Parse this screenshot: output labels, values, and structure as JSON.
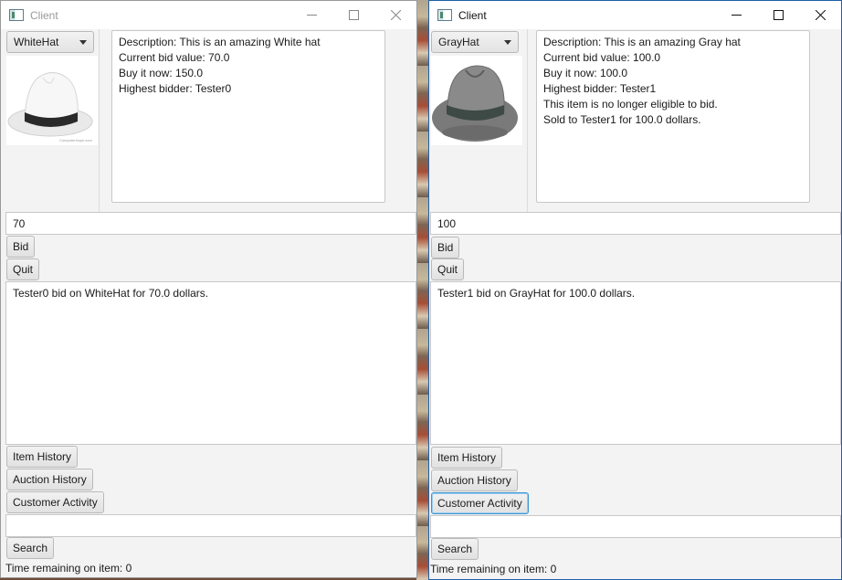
{
  "left": {
    "title": "Client",
    "item_selected": "WhiteHat",
    "description": [
      "Description: This is an amazing White hat",
      "Current bid value: 70.0",
      "Buy it now: 150.0",
      "Highest bidder: Tester0"
    ],
    "bid_value": "70",
    "bid_label": "Bid",
    "quit_label": "Quit",
    "log": "Tester0 bid on WhiteHat for 70.0 dollars.",
    "item_history_label": "Item History",
    "auction_history_label": "Auction History",
    "customer_activity_label": "Customer Activity",
    "search_value": "",
    "search_label": "Search",
    "time_remaining": "Time remaining on item: 0"
  },
  "right": {
    "title": "Client",
    "item_selected": "GrayHat",
    "description": [
      "Description: This is an amazing Gray hat",
      "Current bid value: 100.0",
      "Buy it now: 100.0",
      "Highest bidder: Tester1",
      "This item is no longer eligible to bid.",
      "Sold to Tester1 for 100.0 dollars."
    ],
    "bid_value": "100",
    "bid_label": "Bid",
    "quit_label": "Quit",
    "log": "Tester1 bid on GrayHat for 100.0 dollars.",
    "item_history_label": "Item History",
    "auction_history_label": "Auction History",
    "customer_activity_label": "Customer Activity",
    "search_value": "",
    "search_label": "Search",
    "time_remaining": "Time remaining on item: 0"
  },
  "icons": {
    "app": "app-window-icon",
    "minimize": "minimize-icon",
    "maximize": "maximize-icon",
    "close": "close-icon",
    "dropdown": "chevron-down-icon"
  },
  "colors": {
    "focus_ring": "#3a94d4",
    "active_window_border": "#1f5fa8"
  }
}
